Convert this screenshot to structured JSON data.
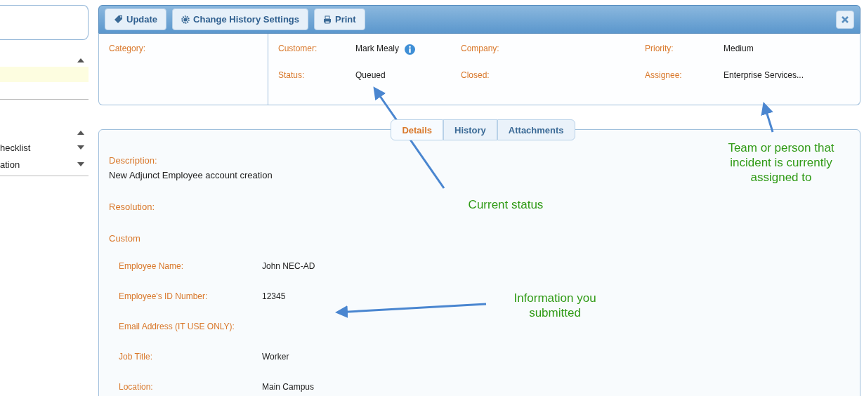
{
  "sidebar": {
    "groups": [
      {
        "expanded": true,
        "highlighted": true
      },
      {
        "expanded": true,
        "highlighted": false,
        "items": [
          {
            "label": "hecklist",
            "expanded": false
          },
          {
            "label": "ation",
            "expanded": false
          }
        ]
      }
    ]
  },
  "toolbar": {
    "buttons": [
      {
        "label": "Update",
        "kind": "tag"
      },
      {
        "label": "Change History Settings",
        "kind": "gear"
      },
      {
        "label": "Print",
        "kind": "printer"
      }
    ]
  },
  "summary": {
    "category_label": "Category:",
    "fields": [
      {
        "label": "Customer:",
        "value": "Mark Mealy",
        "info": true
      },
      {
        "label": "Company:",
        "info": false
      },
      {
        "label": "Priority:",
        "value": "Medium",
        "info": false
      },
      {
        "label": "Status:",
        "value": "Queued",
        "info": false
      },
      {
        "label": "Closed:",
        "info": false
      },
      {
        "label": "Assignee:",
        "value": "Enterprise Services...",
        "info": false
      }
    ]
  },
  "tabs": [
    {
      "label": "Details",
      "selected": true
    },
    {
      "label": "History",
      "selected": false
    },
    {
      "label": "Attachments",
      "selected": false
    }
  ],
  "details": {
    "description_label": "Description:",
    "description": "New Adjunct Employee account creation",
    "resolution_label": "Resolution:",
    "custom_heading": "Custom",
    "custom_fields": [
      {
        "label": "Employee Name:",
        "value": "John NEC-AD"
      },
      {
        "label": "Employee's ID Number:",
        "value": "12345"
      },
      {
        "label": "Email Address (IT USE ONLY):"
      },
      {
        "label": "Job Title:",
        "value": "Worker"
      },
      {
        "label": "Location:",
        "value": "Main Campus"
      }
    ]
  },
  "annotations": [
    {
      "text": "Team or person that incident is currently assigned to"
    },
    {
      "text": "Current status"
    },
    {
      "text": "Information you submitted"
    }
  ]
}
